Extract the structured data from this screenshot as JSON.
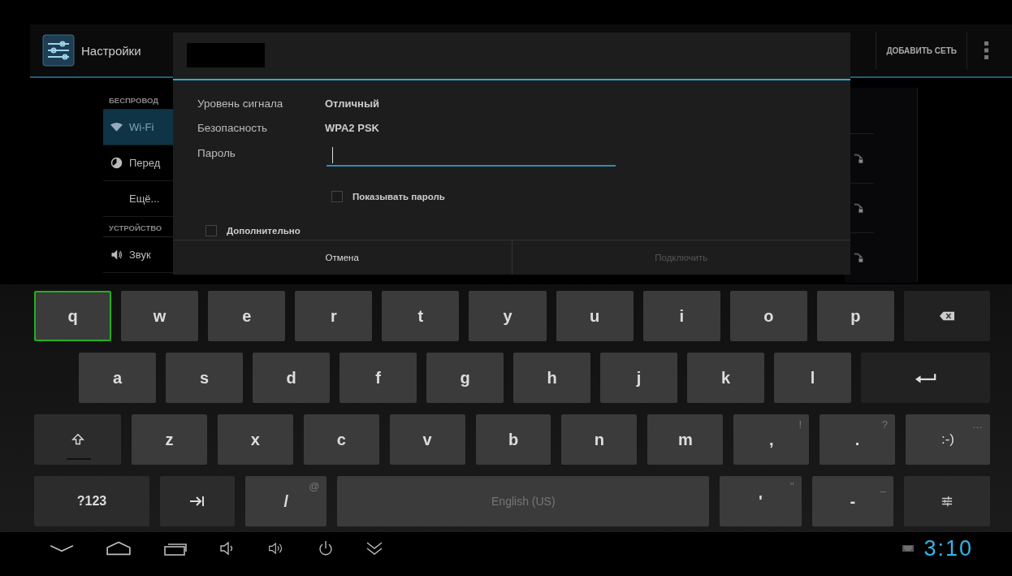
{
  "action_bar": {
    "title": "Настройки",
    "action": "ДОБАВИТЬ СЕТЬ"
  },
  "sidebar": {
    "sections": [
      {
        "header": "БЕСПРОВОД",
        "items": [
          {
            "kind": "wifi",
            "label": "Wi-Fi",
            "selected": true
          },
          {
            "kind": "usage",
            "label": "Перед",
            "selected": false
          },
          {
            "kind": "plain",
            "label": "Ещё...",
            "selected": false
          }
        ]
      },
      {
        "header": "УСТРОЙСТВО",
        "items": [
          {
            "kind": "sound",
            "label": "Звук",
            "selected": false
          }
        ]
      }
    ]
  },
  "dialog": {
    "info": [
      {
        "label": "Уровень сигнала",
        "value": "Отличный"
      },
      {
        "label": "Безопасность",
        "value": "WPA2 PSK"
      }
    ],
    "password": {
      "label": "Пароль"
    },
    "show_password": {
      "label": "Показывать пароль",
      "checked": false
    },
    "advanced": {
      "label": "Дополнительно",
      "checked": false
    },
    "buttons": [
      {
        "label": "Отмена",
        "disabled": false
      },
      {
        "label": "Подключить",
        "disabled": true
      }
    ]
  },
  "keyboard": {
    "rows": [
      {
        "keys": [
          {
            "kind": "char",
            "label": "q",
            "selected": true
          },
          {
            "kind": "char",
            "label": "w",
            "selected": false
          },
          {
            "kind": "char",
            "label": "e",
            "selected": false
          },
          {
            "kind": "char",
            "label": "r",
            "selected": false
          },
          {
            "kind": "char",
            "label": "t",
            "selected": false
          },
          {
            "kind": "char",
            "label": "y",
            "selected": false
          },
          {
            "kind": "char",
            "label": "u",
            "selected": false
          },
          {
            "kind": "char",
            "label": "i",
            "selected": false
          },
          {
            "kind": "char",
            "label": "o",
            "selected": false
          },
          {
            "kind": "char",
            "label": "p",
            "selected": false
          },
          {
            "kind": "backspace",
            "selected": false
          }
        ]
      },
      {
        "keys": [
          {
            "kind": "char",
            "label": "a",
            "selected": false
          },
          {
            "kind": "char",
            "label": "s",
            "selected": false
          },
          {
            "kind": "char",
            "label": "d",
            "selected": false
          },
          {
            "kind": "char",
            "label": "f",
            "selected": false
          },
          {
            "kind": "char",
            "label": "g",
            "selected": false
          },
          {
            "kind": "char",
            "label": "h",
            "selected": false
          },
          {
            "kind": "char",
            "label": "j",
            "selected": false
          },
          {
            "kind": "char",
            "label": "k",
            "selected": false
          },
          {
            "kind": "char",
            "label": "l",
            "selected": false
          },
          {
            "kind": "enter",
            "selected": false
          }
        ]
      },
      {
        "keys": [
          {
            "kind": "shift",
            "selected": false
          },
          {
            "kind": "char",
            "label": "z",
            "selected": false
          },
          {
            "kind": "char",
            "label": "x",
            "selected": false
          },
          {
            "kind": "char",
            "label": "c",
            "selected": false
          },
          {
            "kind": "char",
            "label": "v",
            "selected": false
          },
          {
            "kind": "char",
            "label": "b",
            "selected": false
          },
          {
            "kind": "char",
            "label": "n",
            "selected": false
          },
          {
            "kind": "char",
            "label": "m",
            "selected": false
          },
          {
            "kind": "char",
            "label": ",",
            "hint": "!",
            "selected": false
          },
          {
            "kind": "char",
            "label": ".",
            "hint": "?",
            "selected": false
          },
          {
            "kind": "smiley",
            "label": ":-)",
            "hint": "…",
            "selected": false
          }
        ]
      },
      {
        "keys": [
          {
            "kind": "symbols",
            "label": "?123",
            "selected": false
          },
          {
            "kind": "tab",
            "selected": false
          },
          {
            "kind": "char",
            "label": "/",
            "hint": "@",
            "selected": false
          },
          {
            "kind": "space",
            "label": "English (US)",
            "selected": false
          },
          {
            "kind": "char",
            "label": "'",
            "hint": "\"",
            "selected": false
          },
          {
            "kind": "char",
            "label": "-",
            "hint": "_",
            "selected": false
          },
          {
            "kind": "settings",
            "selected": false
          }
        ]
      }
    ]
  },
  "status_bar": {
    "clock": "3:10"
  }
}
